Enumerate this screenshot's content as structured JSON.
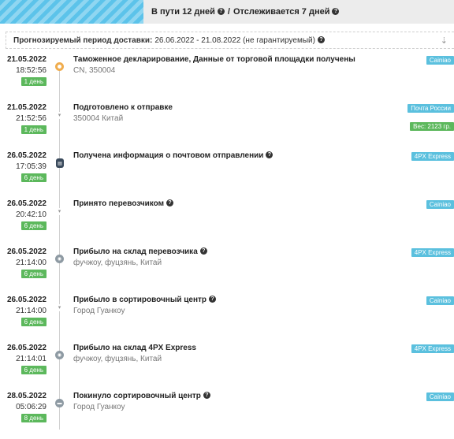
{
  "header": {
    "in_transit": "В пути 12 дней",
    "separator": "/",
    "tracked": "Отслеживается 7 дней"
  },
  "forecast": {
    "label": "Прогнозируемый период доставки:",
    "period": "26.06.2022 - 21.08.2022 (не гарантируемый)"
  },
  "events": [
    {
      "date": "21.05.2022",
      "time": "18:52:56",
      "days": "1 день",
      "title": "Таможенное декларирование, Данные от торговой площадки получены",
      "location": "CN, 350004",
      "carrier": "Cainiao",
      "icon": "customs-icon",
      "help": false
    },
    {
      "date": "21.05.2022",
      "time": "21:52:56",
      "days": "1 день",
      "title": "Подготовлено к отправке",
      "location": "350004 Китай",
      "carrier": "Почта России",
      "weight": "Вес: 2123 гр.",
      "icon": "arrow-down-icon",
      "help": false
    },
    {
      "date": "26.05.2022",
      "time": "17:05:39",
      "days": "6 день",
      "title": "Получена информация о почтовом отправлении",
      "location": "",
      "carrier": "4PX Express",
      "icon": "document-icon",
      "help": true
    },
    {
      "date": "26.05.2022",
      "time": "20:42:10",
      "days": "6 день",
      "title": "Принято перевозчиком",
      "location": "",
      "carrier": "Cainiao",
      "icon": "arrow-down-icon",
      "help": true
    },
    {
      "date": "26.05.2022",
      "time": "21:14:00",
      "days": "6 день",
      "title": "Прибыло на склад перевозчика",
      "location": "фучжоу, фуцзянь, Китай",
      "carrier": "4PX Express",
      "icon": "warehouse-icon",
      "help": true
    },
    {
      "date": "26.05.2022",
      "time": "21:14:00",
      "days": "6 день",
      "title": "Прибыло в сортировочный центр",
      "location": "Город Гуанкоу",
      "carrier": "Cainiao",
      "icon": "arrow-down-icon",
      "help": true
    },
    {
      "date": "26.05.2022",
      "time": "21:14:01",
      "days": "6 день",
      "title": "Прибыло на склад 4PX Express",
      "location": "фучжоу, фуцзянь, Китай",
      "carrier": "4PX Express",
      "icon": "warehouse-icon",
      "help": false
    },
    {
      "date": "28.05.2022",
      "time": "05:06:29",
      "days": "8 день",
      "title": "Покинуло сортировочный центр",
      "location": "Город Гуанкоу",
      "carrier": "Cainiao",
      "icon": "truck-icon",
      "help": true
    }
  ]
}
